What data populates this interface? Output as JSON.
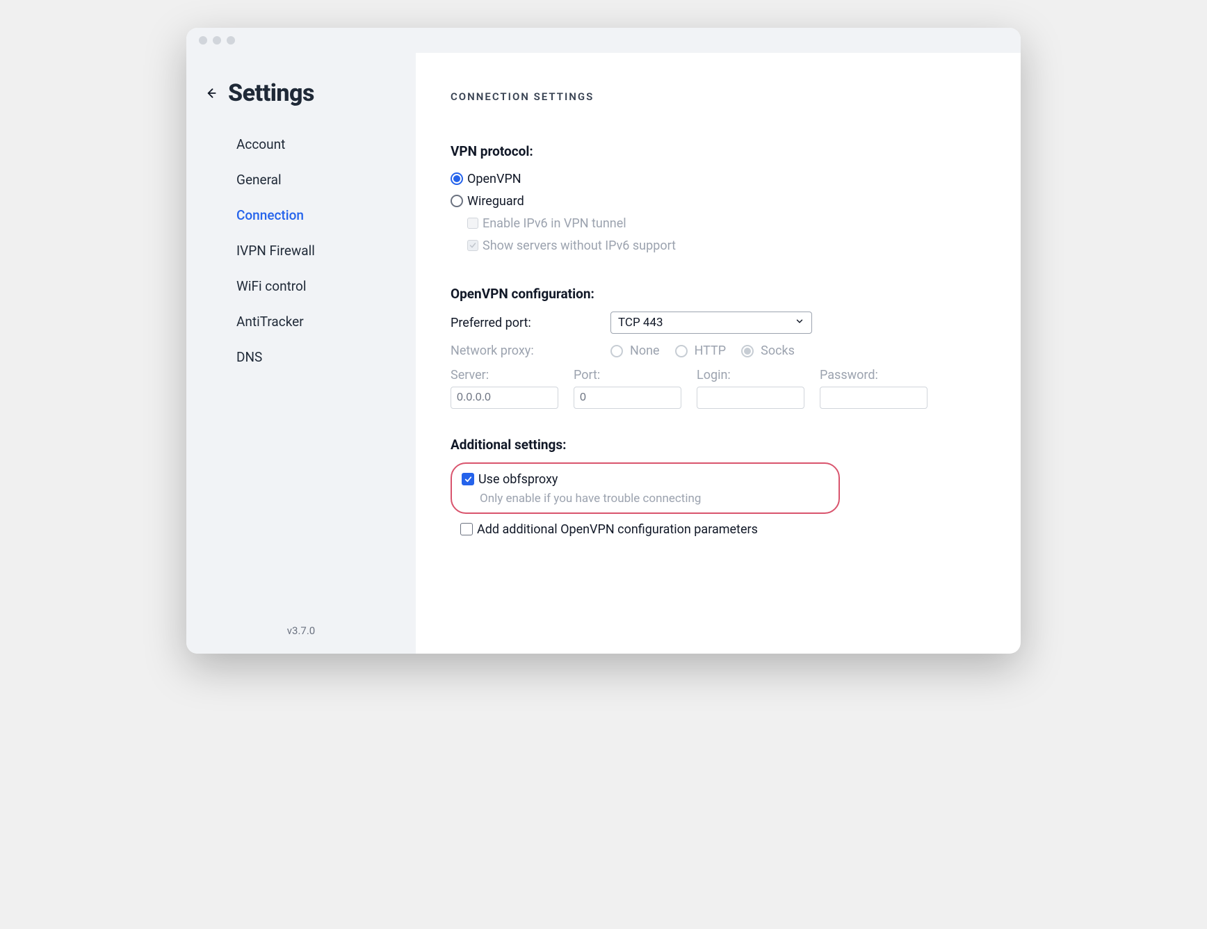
{
  "window": {
    "title": "Settings"
  },
  "sidebar": {
    "items": [
      "Account",
      "General",
      "Connection",
      "IVPN Firewall",
      "WiFi control",
      "AntiTracker",
      "DNS"
    ],
    "active_index": 2,
    "version": "v3.7.0"
  },
  "main": {
    "section_title": "CONNECTION SETTINGS",
    "vpn_protocol": {
      "heading": "VPN protocol:",
      "options": [
        "OpenVPN",
        "Wireguard"
      ],
      "selected_index": 0,
      "enable_ipv6_label": "Enable IPv6 in VPN tunnel",
      "enable_ipv6_checked": false,
      "show_servers_label": "Show servers without IPv6 support",
      "show_servers_checked": true
    },
    "openvpn": {
      "heading": "OpenVPN configuration:",
      "preferred_port_label": "Preferred port:",
      "preferred_port_value": "TCP 443",
      "network_proxy_label": "Network proxy:",
      "proxy_options": [
        "None",
        "HTTP",
        "Socks"
      ],
      "proxy_selected_index": 2,
      "fields": {
        "server_label": "Server:",
        "server_value": "0.0.0.0",
        "port_label": "Port:",
        "port_value": "0",
        "login_label": "Login:",
        "login_value": "",
        "password_label": "Password:",
        "password_value": ""
      }
    },
    "additional": {
      "heading": "Additional settings:",
      "obfsproxy_label": "Use obfsproxy",
      "obfsproxy_checked": true,
      "obfsproxy_hint": "Only enable if you have trouble connecting",
      "extra_params_label": "Add additional OpenVPN configuration parameters",
      "extra_params_checked": false
    }
  }
}
